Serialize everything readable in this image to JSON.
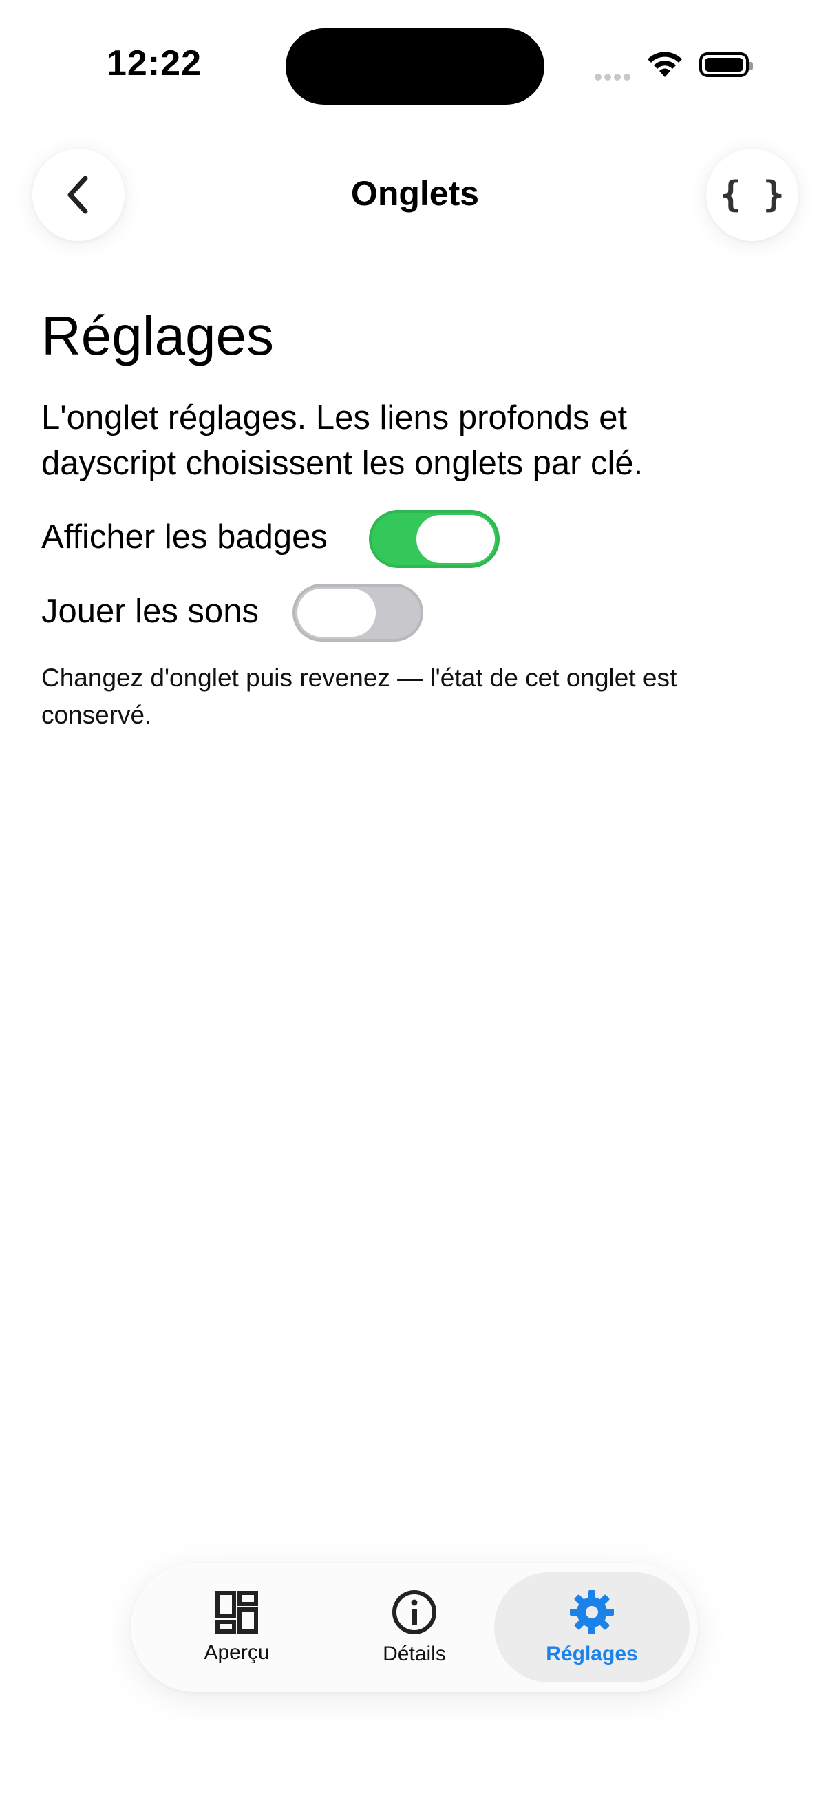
{
  "status_bar": {
    "time": "12:22"
  },
  "nav": {
    "title": "Onglets",
    "back_icon": "chevron-left-icon",
    "code_icon": "curly-braces-icon",
    "code_glyph": "{ }"
  },
  "content": {
    "heading": "Réglages",
    "description": "L'onglet réglages. Les liens profonds et dayscript choisissent les onglets par clé.",
    "toggles": [
      {
        "label": "Afficher les badges",
        "on": true
      },
      {
        "label": "Jouer les sons",
        "on": false
      }
    ],
    "hint": "Changez d'onglet puis revenez — l'état de cet onglet est conservé."
  },
  "tab_bar": {
    "tabs": [
      {
        "label": "Aperçu",
        "icon": "dashboard-icon",
        "selected": false
      },
      {
        "label": "Détails",
        "icon": "info-circle-icon",
        "selected": false
      },
      {
        "label": "Réglages",
        "icon": "gear-icon",
        "selected": true
      }
    ],
    "accent_color": "#1a82e8"
  },
  "colors": {
    "toggle_on": "#34c759",
    "toggle_off": "#c8c8cc"
  }
}
